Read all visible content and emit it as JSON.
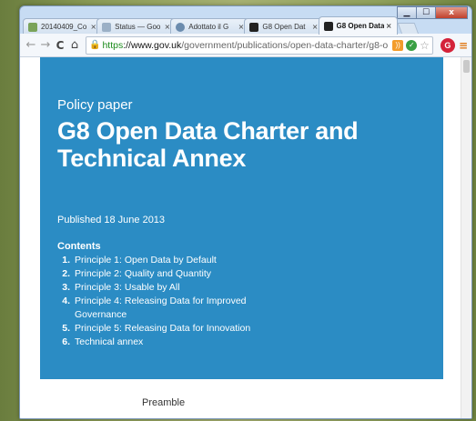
{
  "window": {
    "minimize": "▁",
    "maximize": "☐",
    "close": "x"
  },
  "tabs": [
    {
      "title": "20140409_Co",
      "icon": "image-favicon",
      "color": "#7aa35a"
    },
    {
      "title": "Status — Goo",
      "icon": "status-favicon",
      "color": "#9bb0c6"
    },
    {
      "title": "Adottato il G",
      "icon": "globe-favicon",
      "color": "#6b8cae"
    },
    {
      "title": "G8 Open Dat",
      "icon": "gov-favicon",
      "color": "#222222"
    },
    {
      "title": "G8 Open Data",
      "icon": "gov-favicon",
      "color": "#222222",
      "active": true
    }
  ],
  "toolbar": {
    "back": "←",
    "forward": "→",
    "reload": "C",
    "home": "⌂",
    "url_https": "https",
    "url_host": "://www.gov.uk",
    "url_path": "/government/publications/open-data-charter/g8-o"
  },
  "page": {
    "kicker": "Policy paper",
    "title": "G8 Open Data Charter and Technical Annex",
    "published": "Published 18 June 2013",
    "contents_heading": "Contents",
    "toc": [
      {
        "num": "1.",
        "label": "Principle 1: Open Data by Default"
      },
      {
        "num": "2.",
        "label": "Principle 2: Quality and Quantity"
      },
      {
        "num": "3.",
        "label": "Principle 3: Usable by All"
      },
      {
        "num": "4.",
        "label": "Principle 4: Releasing Data for Improved Governance"
      },
      {
        "num": "5.",
        "label": "Principle 5: Releasing Data for Innovation"
      },
      {
        "num": "6.",
        "label": "Technical annex"
      }
    ],
    "preamble": "Preamble"
  },
  "colors": {
    "hero": "#2b8cc4",
    "https_green": "#1a8a1a"
  }
}
